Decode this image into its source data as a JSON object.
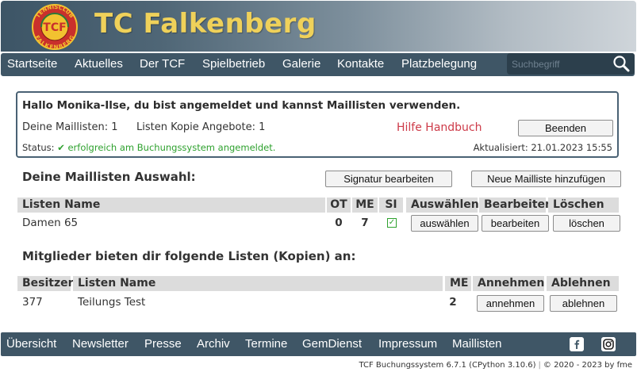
{
  "header": {
    "title": "TC Falkenberg",
    "logo_text": {
      "top": "TENNISCLUB",
      "bottom": "FALKENBERG",
      "center": "TCF"
    }
  },
  "nav": {
    "items": [
      "Startseite",
      "Aktuelles",
      "Der TCF",
      "Spielbetrieb",
      "Galerie",
      "Kontakte",
      "Platzbelegung"
    ],
    "search_placeholder": "Suchbegriff",
    "search_icon": "magnifier-icon"
  },
  "info": {
    "greeting": "Hallo Monika-Ilse, du bist angemeldet und kannst Maillisten verwenden.",
    "my_lists": "Deine Maillisten: 1",
    "copy_offers": "Listen Kopie Angebote: 1",
    "help_link": "Hilfe Handbuch",
    "end_button": "Beenden",
    "status_label": "Status:",
    "status_text": "✔ erfolgreich am Buchungssystem angemeldet.",
    "updated": "Aktualisiert: 21.01.2023 15:55"
  },
  "my_lists_section": {
    "title": "Deine Maillisten Auswahl:",
    "signature_button": "Signatur bearbeiten",
    "new_list_button": "Neue Mailliste hinzufügen",
    "headers": {
      "name": "Listen Name",
      "ot": "OT",
      "me": "ME",
      "si": "SI",
      "select": "Auswählen",
      "edit": "Bearbeiten",
      "delete": "Löschen"
    },
    "rows": [
      {
        "name": "Damen 65",
        "ot": "0",
        "me": "7",
        "si_checked": true,
        "select_btn": "auswählen",
        "edit_btn": "bearbeiten",
        "delete_btn": "löschen"
      }
    ]
  },
  "offers_section": {
    "title": "Mitglieder bieten dir folgende Listen (Kopien) an:",
    "headers": {
      "owner": "Besitzer",
      "name": "Listen Name",
      "me": "ME",
      "accept": "Annehmen",
      "reject": "Ablehnen"
    },
    "rows": [
      {
        "owner": "377",
        "name": "Teilungs Test",
        "me": "2",
        "accept_btn": "annehmen",
        "reject_btn": "ablehnen"
      }
    ]
  },
  "footer": {
    "items": [
      "Übersicht",
      "Newsletter",
      "Presse",
      "Archiv",
      "Termine",
      "GemDienst",
      "Impressum",
      "Maillisten"
    ],
    "social": [
      "facebook-icon",
      "instagram-icon"
    ],
    "version": "TCF Buchungssystem 6.7.1 (CPython 3.10.6)",
    "copyright": "© 2020 - 2023 by fme"
  },
  "colors": {
    "nav_bg": "#3f5666",
    "title_yellow": "#efd15a",
    "help_red": "#cd3a48",
    "success_green": "#2ea12e",
    "logo_red": "#c9302c",
    "logo_yellow": "#f2c230"
  }
}
